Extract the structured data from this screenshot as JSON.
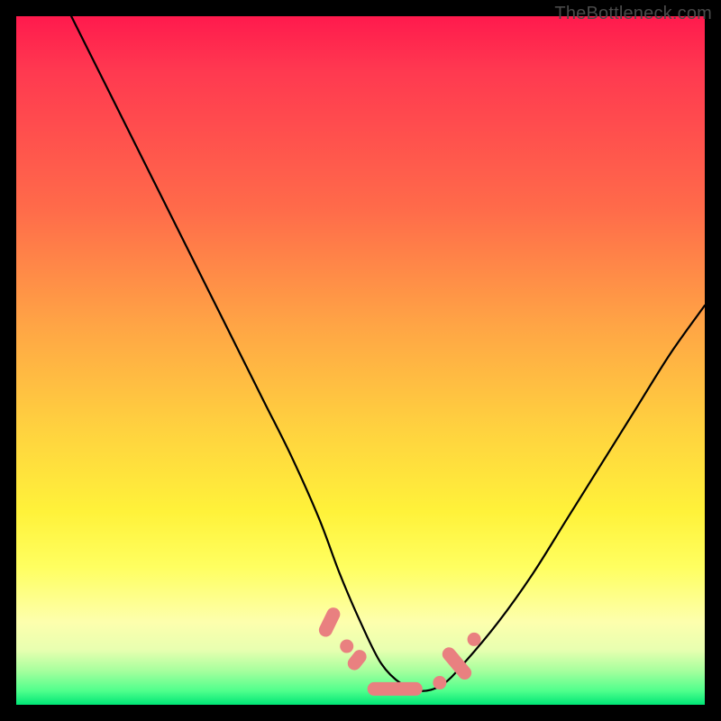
{
  "watermark": "TheBottleneck.com",
  "chart_data": {
    "type": "line",
    "title": "",
    "xlabel": "",
    "ylabel": "",
    "xlim": [
      0,
      100
    ],
    "ylim": [
      0,
      100
    ],
    "grid": false,
    "legend": false,
    "description": "V-shaped bottleneck curve on rainbow gradient background. Y value represents bottleneck percentage (top = 100%, bottom = 0%). Minimum near x≈55. Pink bead markers cluster near the trough.",
    "series": [
      {
        "name": "bottleneck-curve",
        "x": [
          8,
          12,
          16,
          20,
          24,
          28,
          32,
          36,
          40,
          44,
          47,
          50,
          53,
          56,
          59,
          62,
          65,
          70,
          75,
          80,
          85,
          90,
          95,
          100
        ],
        "values": [
          100,
          92,
          84,
          76,
          68,
          60,
          52,
          44,
          36,
          27,
          19,
          12,
          6,
          3,
          2,
          3,
          6,
          12,
          19,
          27,
          35,
          43,
          51,
          58
        ]
      }
    ],
    "markers": [
      {
        "shape": "pill",
        "x": 45.5,
        "y": 12,
        "len": 4.5,
        "angle": -64
      },
      {
        "shape": "round",
        "x": 48.0,
        "y": 8.5
      },
      {
        "shape": "pill",
        "x": 49.5,
        "y": 6.5,
        "len": 3.2,
        "angle": -52
      },
      {
        "shape": "pill",
        "x": 55.0,
        "y": 2.3,
        "len": 8.0,
        "angle": 0
      },
      {
        "shape": "round",
        "x": 61.5,
        "y": 3.2
      },
      {
        "shape": "pill",
        "x": 64.0,
        "y": 6.0,
        "len": 5.5,
        "angle": 50
      },
      {
        "shape": "round",
        "x": 66.5,
        "y": 9.5
      }
    ],
    "gradient_stops": [
      {
        "pos": 0,
        "color": "#ff1a4d"
      },
      {
        "pos": 28,
        "color": "#ff6b4a"
      },
      {
        "pos": 60,
        "color": "#ffd23f"
      },
      {
        "pos": 80,
        "color": "#ffff60"
      },
      {
        "pos": 95,
        "color": "#a8ff9e"
      },
      {
        "pos": 100,
        "color": "#00e676"
      }
    ]
  }
}
